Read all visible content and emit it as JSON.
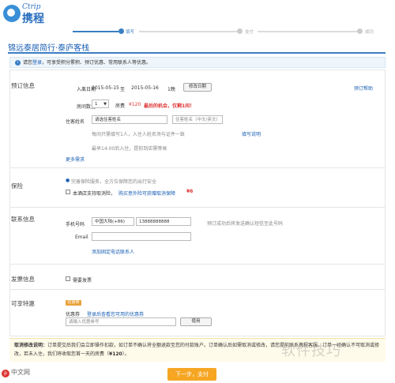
{
  "brand": {
    "logo_en": "Ctrip",
    "logo_cn": "携程"
  },
  "steps": [
    "填写",
    "支付",
    "成功"
  ],
  "page_title": "锦远泰居简行·泰庐客栈",
  "notice": {
    "prefix": "请您",
    "login": "登录",
    "suffix": "，可享受积分累积、预订优惠、常用联系人等优惠。"
  },
  "booking": {
    "label": "预订信息",
    "checkin_label": "入离日期",
    "checkin": "2015-05-15",
    "to": "至",
    "checkout": "2015-05-16",
    "nights": "1晚",
    "modify_button": "修改日期",
    "help_link": "预订帮助",
    "rooms_label": "房间数量",
    "rooms_value": "1",
    "price_prefix": "房费",
    "price_value": "¥120",
    "promo": "最后的机会，仅剩1间！",
    "guest_label": "住客姓名",
    "guest_value": "请选住客姓名",
    "guest_placeholder": "住客姓名（中文/英文）",
    "guest_hint": "每间只需填写1人，入住人姓名须与证件一致",
    "guest_hint_link": "填写说明",
    "arrival_hint": "最早14:00后入住，提前到店需等候",
    "more_link": "更多需求"
  },
  "insurance": {
    "label": "保险",
    "desc": "完善保险服务，全方位保障您的出行安全",
    "option": "本酒店支持取消险，",
    "option_link": "购买意外险可获赠取消保障",
    "badge": "¥6"
  },
  "contact": {
    "label": "联系信息",
    "phone_label": "手机号码",
    "country_code": "中国大陆(+86)",
    "phone_value": "13888888888",
    "phone_hint": "预订成功后将发送确认短信至此号码",
    "email_label": "Email",
    "email_value": "",
    "landline_link": "添加固定电话联系人"
  },
  "invoice": {
    "label": "发票信息",
    "option": "需要发票"
  },
  "discount": {
    "label": "可享特惠",
    "tag": "优惠券",
    "title": "优惠券",
    "link": "登录后查看您可用的优惠券",
    "placeholder": "请输入优惠券号",
    "use_button": "使用"
  },
  "cancel_policy": {
    "title": "取消修改说明：",
    "text1": "订单提交后我们会立即操作扣款，如订单不确认将全额退款至您的付款账户。订单确认后如需取消或修改，请您提前联系携程客服。订单一经确认不可取消或修改，若未入住，我们将收取您首一天的房费（",
    "fee": "¥120",
    "text2": "）。"
  },
  "next_button": "下一步，支付",
  "watermark": "软件技巧",
  "php_logo": "中文网"
}
